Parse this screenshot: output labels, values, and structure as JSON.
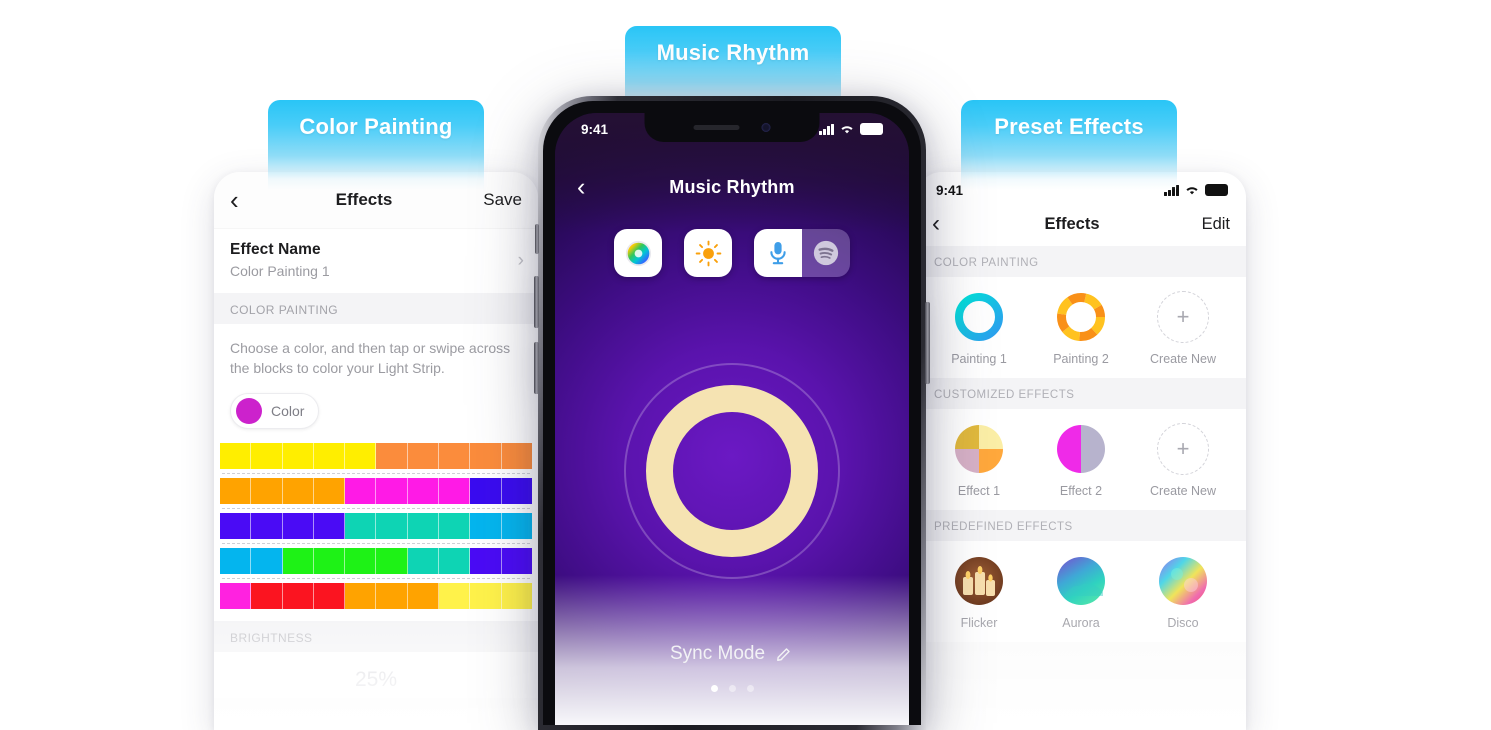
{
  "badges": [
    {
      "label": "Color Painting",
      "name": "badge-color-painting"
    },
    {
      "label": "Music Rhythm",
      "name": "badge-music-rhythm"
    },
    {
      "label": "Preset Effects",
      "name": "badge-preset-effects"
    }
  ],
  "accent_color": "#34c6f4",
  "left_phone": {
    "nav": {
      "back_icon": "chevron-left",
      "title": "Effects",
      "save_label": "Save"
    },
    "effect_name": {
      "title": "Effect Name",
      "value": "Color Painting 1",
      "chevron": "chevron-right"
    },
    "section_color_painting": "COLOR PAINTING",
    "description": "Choose a color, and then tap or swipe across the blocks to color your Light Strip.",
    "color_chip": {
      "label": "Color",
      "swatch": "#cc22cc"
    },
    "grid_rows": [
      [
        "#ffee00",
        "#ffee00",
        "#ffee00",
        "#ffee00",
        "#ffee00",
        "#fb8c3c",
        "#fb8c3c",
        "#fb8c3c",
        "#fb8c3c",
        "#fb8c3c"
      ],
      [
        "#ffa300",
        "#ffa300",
        "#ffa300",
        "#ffa300",
        "#ff1ae6",
        "#ff1ae6",
        "#ff1ae6",
        "#ff1ae6",
        "#3a0bf0",
        "#3a0bf0"
      ],
      [
        "#4a0bf5",
        "#4a0bf5",
        "#4a0bf5",
        "#4a0bf5",
        "#0ed4b4",
        "#0ed4b4",
        "#0ed4b4",
        "#0ed4b4",
        "#04b5ee",
        "#04b5ee"
      ],
      [
        "#04b5ee",
        "#04b5ee",
        "#1ef216",
        "#1ef216",
        "#1ef216",
        "#1ef216",
        "#0ed4b4",
        "#0ed4b4",
        "#4a0bf5",
        "#4a0bf5"
      ],
      [
        "#ff22e0",
        "#fb1420",
        "#fb1420",
        "#fb1420",
        "#ffa300",
        "#ffa300",
        "#ffa300",
        "#fff24a",
        "#fff24a",
        "#fff24a"
      ]
    ],
    "section_brightness": "BRIGHTNESS",
    "brightness_value": "25%"
  },
  "center_phone": {
    "status": {
      "time": "9:41",
      "signal_icon": "cellular-bars",
      "wifi_icon": "wifi",
      "battery_icon": "battery-full"
    },
    "nav": {
      "back_icon": "chevron-left",
      "title": "Music Rhythm"
    },
    "mode_buttons": [
      {
        "name": "color-wheel-button",
        "icon": "color-wheel-icon",
        "selected": true
      },
      {
        "name": "brightness-button",
        "icon": "sun-icon",
        "selected": true
      },
      {
        "name": "microphone-button",
        "icon": "microphone-icon",
        "selected": true
      },
      {
        "name": "spotify-button",
        "icon": "spotify-icon",
        "selected": false
      }
    ],
    "visualizer": {
      "ring_color": "#f5e3b2",
      "outer_ring_color": "rgba(255,255,255,0.23)"
    },
    "sync": {
      "label": "Sync Mode",
      "edit_icon": "pencil-icon"
    },
    "page_dots": {
      "count": 3,
      "active_index": 0
    }
  },
  "right_phone": {
    "status": {
      "time": "9:41",
      "signal_icon": "cellular-bars",
      "wifi_icon": "wifi",
      "battery_icon": "battery-full"
    },
    "nav": {
      "back_icon": "chevron-left",
      "title": "Effects",
      "edit_label": "Edit"
    },
    "sections": [
      {
        "header": "COLOR PAINTING",
        "items": [
          {
            "label": "Painting 1",
            "thumb": "ring-cyan"
          },
          {
            "label": "Painting 2",
            "thumb": "ring-orange-segments"
          },
          {
            "label": "Create New",
            "thumb": "create-new"
          }
        ]
      },
      {
        "header": "CUSTOMIZED EFFECTS",
        "items": [
          {
            "label": "Effect 1",
            "thumb": "quadrant-warm"
          },
          {
            "label": "Effect 2",
            "thumb": "split-magenta-grey"
          },
          {
            "label": "Create New",
            "thumb": "create-new"
          }
        ]
      },
      {
        "header": "PREDEFINED EFFECTS",
        "items": [
          {
            "label": "Flicker",
            "thumb": "candles"
          },
          {
            "label": "Aurora",
            "thumb": "aurora"
          },
          {
            "label": "Disco",
            "thumb": "disco"
          }
        ]
      }
    ]
  }
}
